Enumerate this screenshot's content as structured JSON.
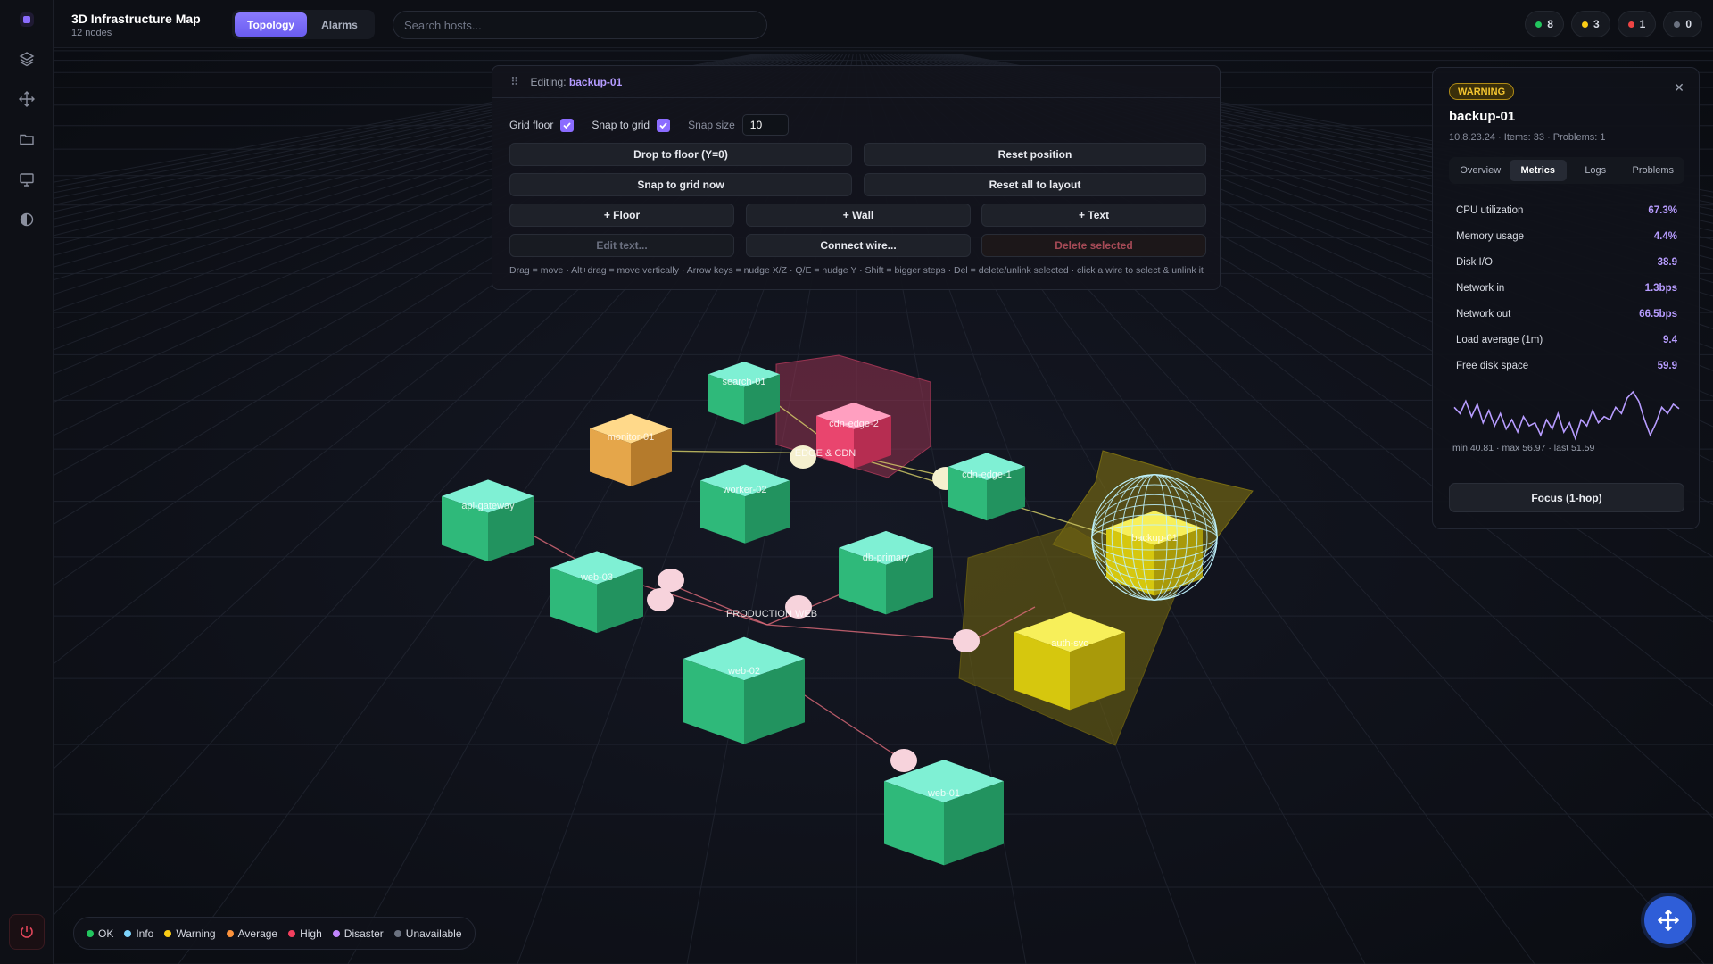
{
  "app": {
    "title": "3D Infrastructure Map",
    "subtitle": "12 nodes"
  },
  "tabs": [
    {
      "label": "Topology",
      "active": true
    },
    {
      "label": "Alarms",
      "active": false
    }
  ],
  "search": {
    "placeholder": "Search hosts...",
    "value": ""
  },
  "counts": [
    {
      "value": "8",
      "color": "#22c55e"
    },
    {
      "value": "3",
      "color": "#facc15"
    },
    {
      "value": "1",
      "color": "#ef4444"
    },
    {
      "value": "0",
      "color": "#6b7280"
    }
  ],
  "editor": {
    "editing_label": "Editing:",
    "editing_host": "backup-01",
    "grid_floor": {
      "label": "Grid floor",
      "checked": true
    },
    "snap_to_grid": {
      "label": "Snap to grid",
      "checked": true
    },
    "snap_size": {
      "label": "Snap size",
      "value": "10"
    },
    "buttons": {
      "drop_to_floor": "Drop to floor (Y=0)",
      "reset_position": "Reset position",
      "snap_now": "Snap to grid now",
      "reset_all": "Reset all to layout",
      "add_floor": "+ Floor",
      "add_wall": "+ Wall",
      "add_text": "+ Text",
      "edit_text": "Edit text...",
      "connect_wire": "Connect wire...",
      "delete_selected": "Delete selected"
    },
    "hint": "Drag = move · Alt+drag = move vertically · Arrow keys = nudge X/Z · Q/E = nudge Y · Shift = bigger steps · Del = delete/unlink selected · click a wire to select & unlink it"
  },
  "details": {
    "status": "WARNING",
    "status_color": "#f4c530",
    "host": "backup-01",
    "meta": "10.8.23.24 · Items: 33 · Problems: 1",
    "tabs": [
      {
        "label": "Overview",
        "active": false
      },
      {
        "label": "Metrics",
        "active": true
      },
      {
        "label": "Logs",
        "active": false
      },
      {
        "label": "Problems",
        "active": false
      }
    ],
    "metrics": [
      {
        "label": "CPU utilization",
        "value": "67.3%"
      },
      {
        "label": "Memory usage",
        "value": "4.4%"
      },
      {
        "label": "Disk I/O",
        "value": "38.9"
      },
      {
        "label": "Network in",
        "value": "1.3bps"
      },
      {
        "label": "Network out",
        "value": "66.5bps"
      },
      {
        "label": "Load average (1m)",
        "value": "9.4"
      },
      {
        "label": "Free disk space",
        "value": "59.9"
      }
    ],
    "sparkline": {
      "values": [
        52,
        50,
        54,
        49,
        53,
        47,
        51,
        46,
        50,
        45,
        48,
        44,
        49,
        46,
        47,
        43,
        48,
        45,
        50,
        44,
        47,
        42,
        48,
        46,
        51,
        47,
        49,
        48,
        52,
        50,
        55,
        57,
        54,
        48,
        43,
        47,
        52,
        50,
        53,
        51.59
      ],
      "caption": "min 40.81 · max 56.97 · last 51.59"
    },
    "focus_button": "Focus (1-hop)"
  },
  "scene": {
    "nodes": [
      {
        "name": "search-01",
        "status": "ok"
      },
      {
        "name": "cdn-edge-2",
        "status": "high"
      },
      {
        "name": "monitor-01",
        "status": "average"
      },
      {
        "name": "worker-02",
        "status": "ok"
      },
      {
        "name": "cdn-edge-1",
        "status": "ok"
      },
      {
        "name": "api-gateway",
        "status": "ok"
      },
      {
        "name": "web-03",
        "status": "ok"
      },
      {
        "name": "db-primary",
        "status": "ok"
      },
      {
        "name": "backup-01",
        "status": "warning"
      },
      {
        "name": "auth-svc",
        "status": "warning"
      },
      {
        "name": "web-02",
        "status": "ok"
      },
      {
        "name": "web-01",
        "status": "ok"
      }
    ],
    "groups": [
      {
        "name": "EDGE & CDN"
      },
      {
        "name": "PRODUCTION WEB"
      }
    ]
  },
  "legend": [
    {
      "label": "OK",
      "color": "#22c55e"
    },
    {
      "label": "Info",
      "color": "#7dd3fc"
    },
    {
      "label": "Warning",
      "color": "#facc15"
    },
    {
      "label": "Average",
      "color": "#fb923c"
    },
    {
      "label": "High",
      "color": "#f43f5e"
    },
    {
      "label": "Disaster",
      "color": "#c084fc"
    },
    {
      "label": "Unavailable",
      "color": "#6b7280"
    }
  ]
}
